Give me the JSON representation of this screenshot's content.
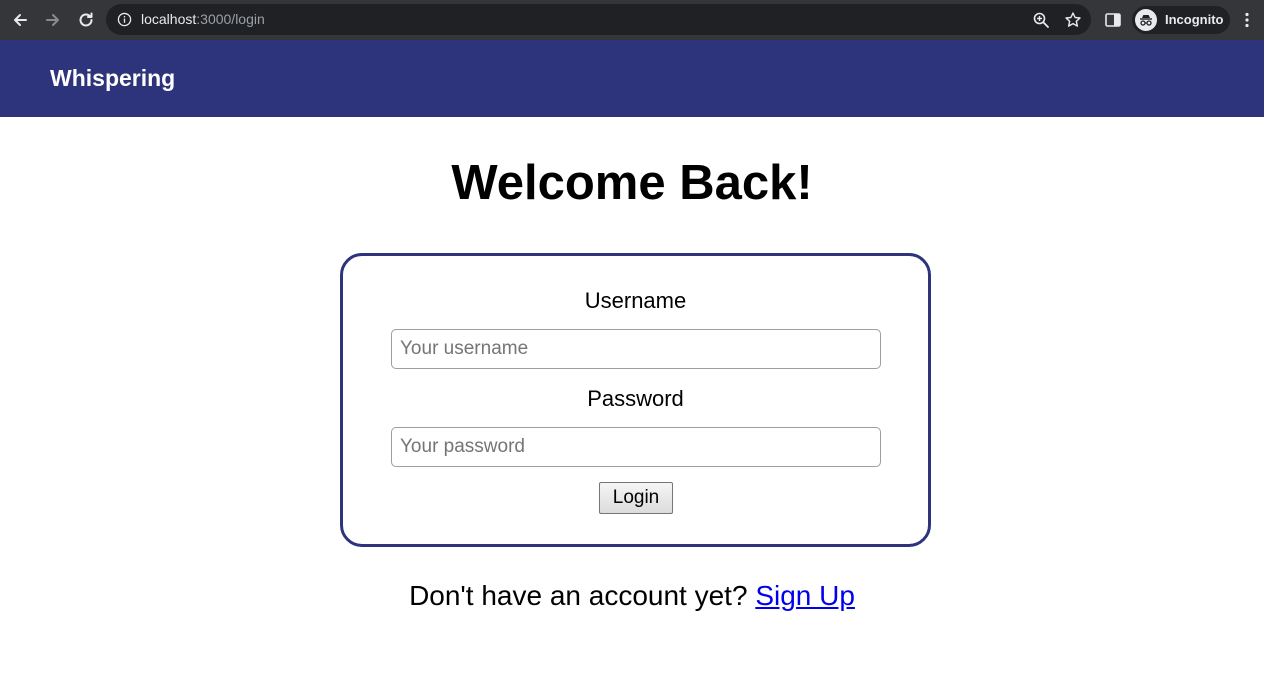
{
  "browser": {
    "url_host": "localhost",
    "url_path": ":3000/login",
    "incognito_label": "Incognito"
  },
  "header": {
    "brand": "Whispering",
    "background_color": "#2e347c"
  },
  "main": {
    "title": "Welcome Back!",
    "form": {
      "username_label": "Username",
      "username_placeholder": "Your username",
      "username_value": "",
      "password_label": "Password",
      "password_placeholder": "Your password",
      "password_value": "",
      "submit_label": "Login"
    },
    "signup": {
      "prompt": "Don't have an account yet?",
      "link_label": "Sign Up"
    }
  },
  "icons": {
    "back": "arrow-left",
    "forward": "arrow-right",
    "reload": "reload",
    "site_info": "info-circle",
    "zoom": "magnifier-zoom",
    "bookmark": "star",
    "side_panel": "side-panel",
    "incognito": "incognito-spy",
    "menu": "vertical-dots"
  },
  "colors": {
    "accent": "#2e347c",
    "link": "#0000ee",
    "chrome_bar": "#35363a",
    "omnibox": "#202124"
  }
}
